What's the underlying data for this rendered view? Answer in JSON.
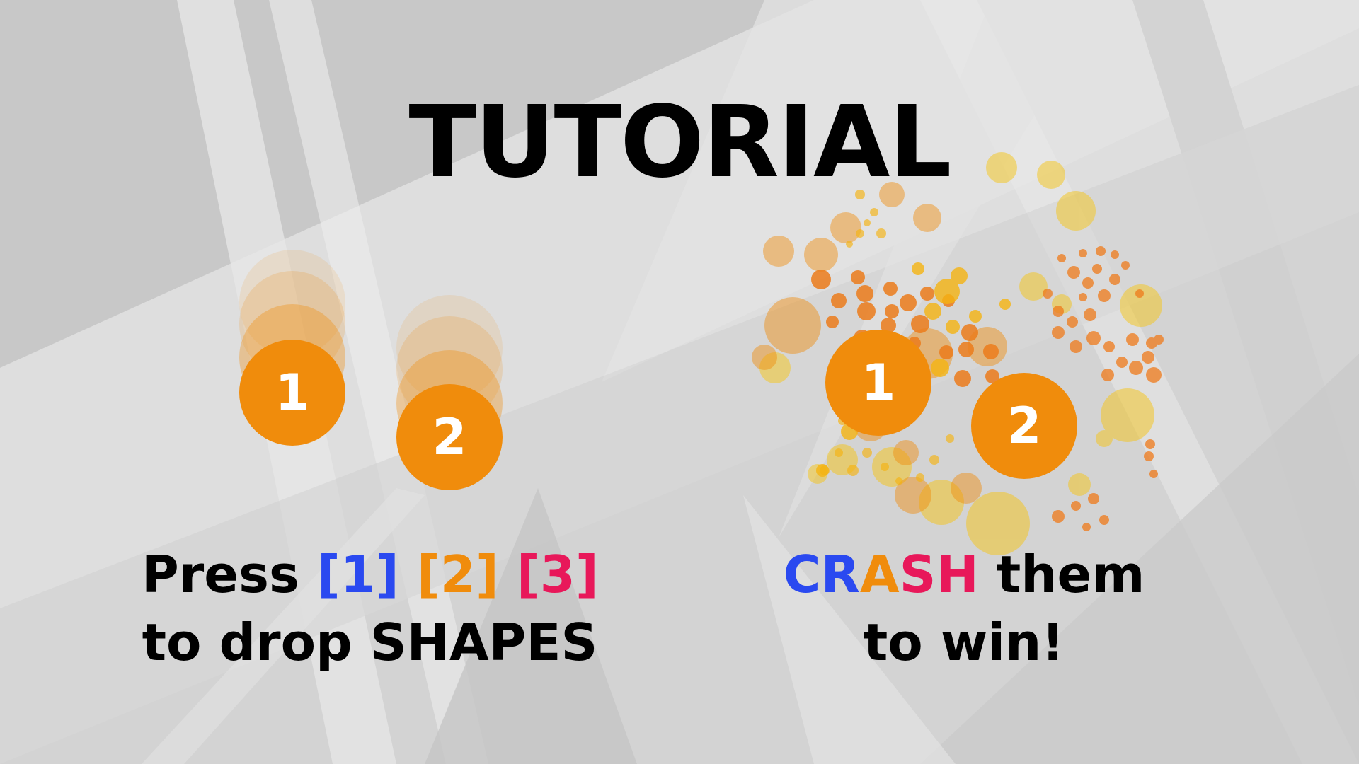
{
  "title": "TUTORIAL",
  "left_panel": {
    "ball_1_label": "1",
    "ball_2_label": "2",
    "caption_line1": {
      "prefix": "Press ",
      "key1": "[1]",
      "key2": "[2]",
      "key3": "[3]"
    },
    "caption_line2": "to drop SHAPES"
  },
  "right_panel": {
    "ball_1_label": "1",
    "ball_2_label": "2",
    "caption_line1": {
      "c": "C",
      "r": "R",
      "a": "A",
      "s": "S",
      "h": "H",
      "suffix": " them"
    },
    "caption_line2": "to win!"
  },
  "colors": {
    "ball": "#f08c0c",
    "blue": "#2a49f0",
    "orange": "#f08c0c",
    "pink": "#e8185a",
    "yellow": "#f5c518"
  }
}
